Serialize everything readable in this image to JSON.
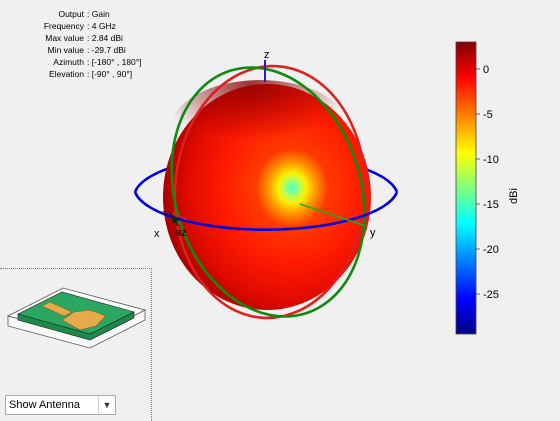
{
  "info": {
    "rows": [
      {
        "key": "Output",
        "val": "Gain"
      },
      {
        "key": "Frequency",
        "val": "4 GHz"
      },
      {
        "key": "Max value",
        "val": "2.84 dBi"
      },
      {
        "key": "Min value",
        "val": "-29.7 dBi"
      },
      {
        "key": "Azimuth",
        "val": "[-180° , 180°]"
      },
      {
        "key": "Elevation",
        "val": "[-90° , 90°]"
      }
    ]
  },
  "axes": {
    "x": "x",
    "y": "y",
    "z": "z",
    "az": "az",
    "el": "el"
  },
  "colorbar": {
    "label": "dBi",
    "ticks": [
      "0",
      "-5",
      "-10",
      "-15",
      "-20",
      "-25"
    ],
    "colors": [
      "#800000",
      "#ff0000",
      "#ff8000",
      "#ffff00",
      "#80ff80",
      "#00ffff",
      "#0080ff",
      "#0000ff",
      "#000080"
    ]
  },
  "controls": {
    "show_select": "Show Antenna",
    "show_select_options": [
      "Show Antenna"
    ]
  },
  "colors": {
    "azimuth_ring": "#0000e0",
    "elevation_ring_red": "#e02020",
    "elevation_ring_green": "#108a10"
  }
}
